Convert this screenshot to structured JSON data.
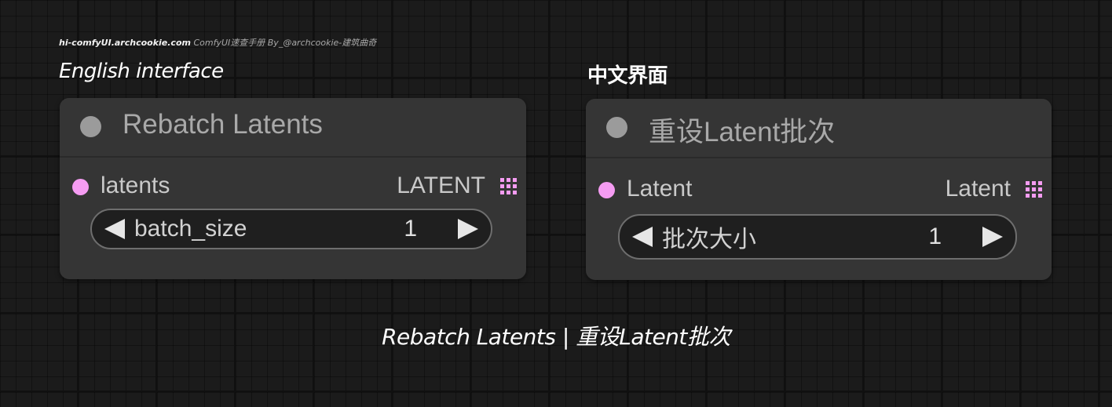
{
  "watermark": {
    "domain": "hi-comfyUI.archcookie.com",
    "rest": " ComfyUI速查手册  By_@archcookie-建筑曲奇"
  },
  "labels": {
    "english": "English interface",
    "chinese": "中文界面"
  },
  "nodes": [
    {
      "title": "Rebatch Latents",
      "input_label": "latents",
      "output_type": "LATENT",
      "widget_label": "batch_size",
      "widget_value": "1"
    },
    {
      "title": "重设Latent批次",
      "input_label": "Latent",
      "output_type": "Latent",
      "widget_label": "批次大小",
      "widget_value": "1"
    }
  ],
  "caption": "Rebatch Latents | 重设Latent批次",
  "colors": {
    "background": "#1b1b1b",
    "node_bg": "#353535",
    "latent_slot": "#f59cf2",
    "title_dot": "#9b9b9b"
  },
  "icons": {
    "left_arrow": "triangle-left",
    "right_arrow": "triangle-right",
    "output_grid": "grid-3x3"
  }
}
